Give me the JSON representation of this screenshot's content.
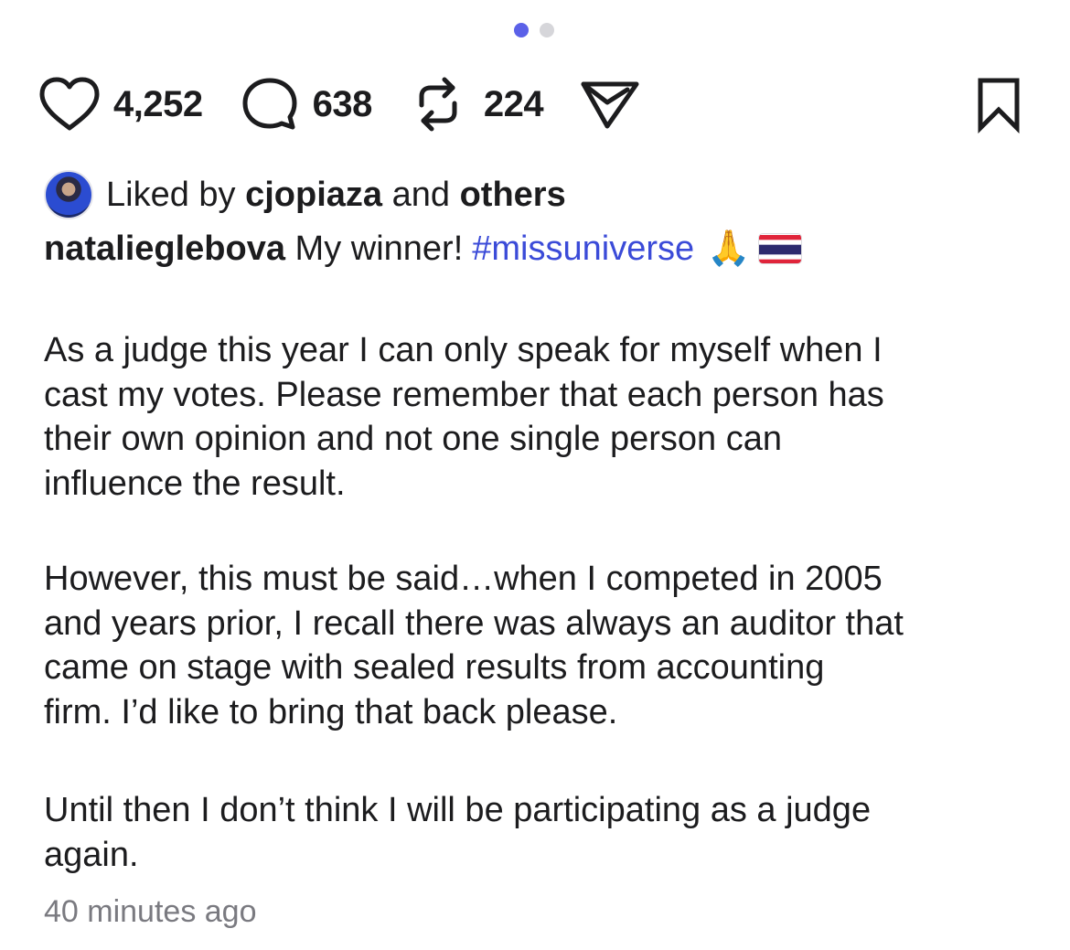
{
  "pager": {
    "pages": 2,
    "active_index": 0
  },
  "actions": {
    "like_count": "4,252",
    "comment_count": "638",
    "repost_count": "224",
    "icons": [
      "heart-icon",
      "comment-icon",
      "repost-icon",
      "send-icon",
      "bookmark-icon"
    ]
  },
  "liked_by": {
    "prefix": "Liked by",
    "user": "cjopiaza",
    "joiner": "and",
    "others": "others"
  },
  "caption": {
    "username": "natalieglebova",
    "text": "My winner!",
    "hashtag": "#missuniverse",
    "emoji": "🙏"
  },
  "body": [
    "As a judge this year I can only speak for myself when I\ncast my votes. Please remember that each person has\ntheir own opinion and not one single person can\ninfluence the result.",
    "However, this must be said…when I competed in 2005\nand years prior, I recall there was always an auditor that\ncame on stage with sealed results from accounting\nfirm. I’d like to bring that back please.",
    "Until then I don’t think I will be participating as a judge\nagain."
  ],
  "timestamp": "40 minutes ago",
  "colors": {
    "accent_dot": "#5b61e8",
    "hashtag": "#3b4bd8",
    "muted": "#7a7a80",
    "text": "#1c1c1e"
  }
}
